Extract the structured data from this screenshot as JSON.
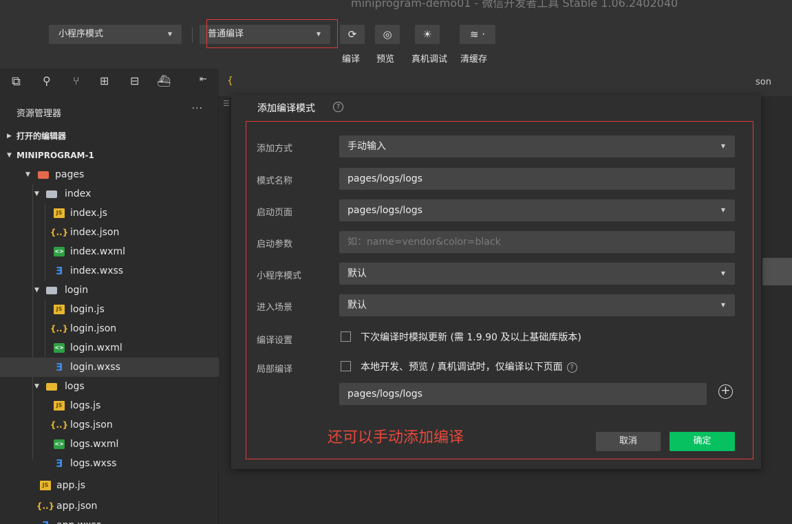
{
  "window": {
    "title": "miniprogram-demo01 - 微信开发者工具 Stable 1.06.2402040"
  },
  "toolbar": {
    "mode_select": "小程序模式",
    "compile_select": "普通编译",
    "buttons": [
      {
        "label": "编译",
        "icon": "refresh-icon"
      },
      {
        "label": "预览",
        "icon": "eye-icon"
      },
      {
        "label": "真机调试",
        "icon": "bug-icon"
      },
      {
        "label": "清缓存",
        "icon": "layers-icon"
      }
    ]
  },
  "activity_bar": {
    "icons": [
      "files-icon",
      "search-icon",
      "source-control-icon",
      "extensions-icon",
      "layout-icon",
      "docker-icon",
      "collapse-panel-icon"
    ]
  },
  "explorer": {
    "header": "资源管理器",
    "more": "···",
    "open_editors": "打开的编辑器",
    "project": "MINIPROGRAM-1",
    "tree": [
      {
        "label": "pages",
        "type": "folder-pages"
      },
      {
        "label": "index",
        "type": "folder"
      },
      {
        "label": "index.js",
        "type": "js"
      },
      {
        "label": "index.json",
        "type": "json"
      },
      {
        "label": "index.wxml",
        "type": "wxml"
      },
      {
        "label": "index.wxss",
        "type": "wxss"
      },
      {
        "label": "login",
        "type": "folder"
      },
      {
        "label": "login.js",
        "type": "js"
      },
      {
        "label": "login.json",
        "type": "json"
      },
      {
        "label": "login.wxml",
        "type": "wxml"
      },
      {
        "label": "login.wxss",
        "type": "wxss"
      },
      {
        "label": "logs",
        "type": "folder-logs"
      },
      {
        "label": "logs.js",
        "type": "js"
      },
      {
        "label": "logs.json",
        "type": "json"
      },
      {
        "label": "logs.wxml",
        "type": "wxml"
      },
      {
        "label": "logs.wxss",
        "type": "wxss"
      },
      {
        "label": "app.js",
        "type": "js"
      },
      {
        "label": "app.json",
        "type": "json"
      },
      {
        "label": "app.wxss",
        "type": "wxss"
      }
    ]
  },
  "editor": {
    "tab_fragment": "son"
  },
  "dialog": {
    "title": "添加编译模式",
    "fields": {
      "add_method": {
        "label": "添加方式",
        "value": "手动输入"
      },
      "mode_name": {
        "label": "模式名称",
        "value": "pages/logs/logs"
      },
      "start_page": {
        "label": "启动页面",
        "value": "pages/logs/logs"
      },
      "start_params": {
        "label": "启动参数",
        "placeholder": "如：name=vendor&color=black"
      },
      "mp_mode": {
        "label": "小程序模式",
        "value": "默认"
      },
      "scene": {
        "label": "进入场景",
        "value": "默认"
      }
    },
    "compile_settings": {
      "label": "编译设置",
      "checkbox": "下次编译时模拟更新 (需 1.9.90 及以上基础库版本)"
    },
    "partial_compile": {
      "label": "局部编译",
      "checkbox": "本地开发、预览 / 真机调试时，仅编译以下页面",
      "page": "pages/logs/logs"
    },
    "annotation": "还可以手动添加编译",
    "cancel": "取消",
    "ok": "确定"
  },
  "colors": {
    "accent_green": "#07c160",
    "annotation_red": "#e8483a",
    "highlight_box": "#e03a3a"
  }
}
